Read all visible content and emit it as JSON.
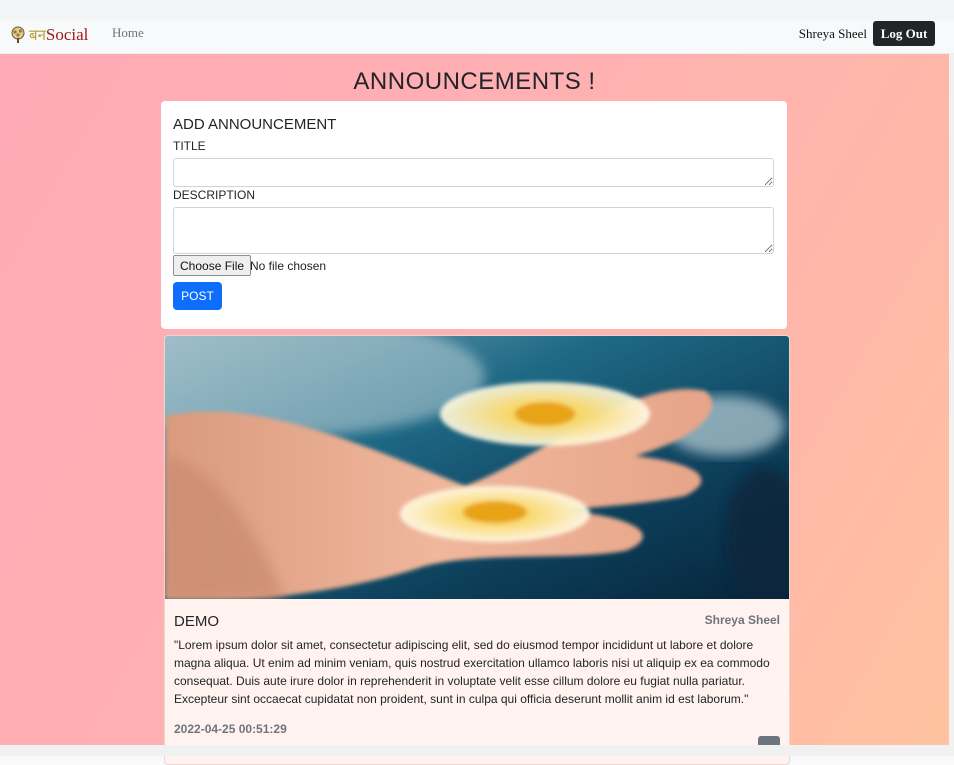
{
  "navbar": {
    "brand_hindi": "बन",
    "brand_text": "Social",
    "home_label": "Home",
    "user_name": "Shreya Sheel",
    "logout_label": "Log Out"
  },
  "page": {
    "title": "ANNOUNCEMENTS !"
  },
  "form": {
    "heading": "ADD ANNOUNCEMENT",
    "title_label": "TITLE",
    "title_value": "",
    "description_label": "DESCRIPTION",
    "description_value": "",
    "choose_file_label": "Choose File",
    "file_status": "No file chosen",
    "post_label": "POST"
  },
  "posts": [
    {
      "title": "DEMO",
      "author": "Shreya Sheel",
      "description": "\"Lorem ipsum dolor sit amet, consectetur adipiscing elit, sed do eiusmod tempor incididunt ut labore et dolore magna aliqua. Ut enim ad minim veniam, quis nostrud exercitation ullamco laboris nisi ut aliquip ex ea commodo consequat. Duis aute irure dolor in reprehenderit in voluptate velit esse cillum dolore eu fugiat nulla pariatur. Excepteur sint occaecat cupidatat non proident, sunt in culpa qui officia deserunt mollit anim id est laborum.\"",
      "timestamp": "2022-04-25 00:51:29"
    }
  ],
  "colors": {
    "navbar_bg": "#f8f9fa",
    "logout_bg": "#212529",
    "post_button": "#0d6efd",
    "background_gradient_start": "#ffaab6",
    "background_gradient_end": "#ffc3a0"
  },
  "icons": {
    "brand_logo": "tree-logo-icon"
  }
}
